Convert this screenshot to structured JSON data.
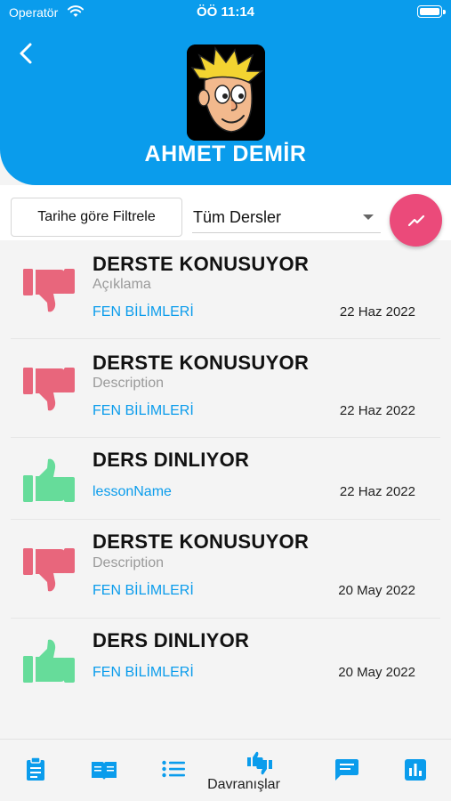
{
  "status_bar": {
    "carrier": "Operatör",
    "time": "ÖÖ 11:14"
  },
  "header": {
    "student_name": "AHMET DEMİR"
  },
  "filters": {
    "date_filter_label": "Tarihe göre Filtrele",
    "lesson_select_value": "Tüm Dersler"
  },
  "colors": {
    "brand": "#0a9cec",
    "fab": "#eb4a7a",
    "negative": "#e8667c",
    "positive": "#66dc9a"
  },
  "behaviors": [
    {
      "title": "DERSTE KONUSUYOR",
      "description": "Açıklama",
      "lesson": "FEN BİLİMLERİ",
      "date": "22 Haz 2022",
      "type": "negative",
      "icon": "thumbs-down-icon"
    },
    {
      "title": "DERSTE KONUSUYOR",
      "description": "Description",
      "lesson": "FEN BİLİMLERİ",
      "date": "22 Haz 2022",
      "type": "negative",
      "icon": "thumbs-down-icon"
    },
    {
      "title": "DERS DINLIYOR",
      "description": "",
      "lesson": "lessonName",
      "date": "22 Haz 2022",
      "type": "positive",
      "icon": "thumbs-up-icon"
    },
    {
      "title": "DERSTE KONUSUYOR",
      "description": "Description",
      "lesson": "FEN BİLİMLERİ",
      "date": "20 May 2022",
      "type": "negative",
      "icon": "thumbs-down-icon"
    },
    {
      "title": "DERS DINLIYOR",
      "description": "",
      "lesson": "FEN BİLİMLERİ",
      "date": "20 May 2022",
      "type": "positive",
      "icon": "thumbs-up-icon"
    }
  ],
  "bottom_nav": {
    "items": [
      {
        "icon": "clipboard-icon"
      },
      {
        "icon": "open-book-icon"
      },
      {
        "icon": "list-icon"
      },
      {
        "icon": "thumbs-up-down-icon",
        "label": "Davranışlar",
        "active": true
      },
      {
        "icon": "chat-icon"
      },
      {
        "icon": "bar-chart-icon"
      }
    ]
  }
}
